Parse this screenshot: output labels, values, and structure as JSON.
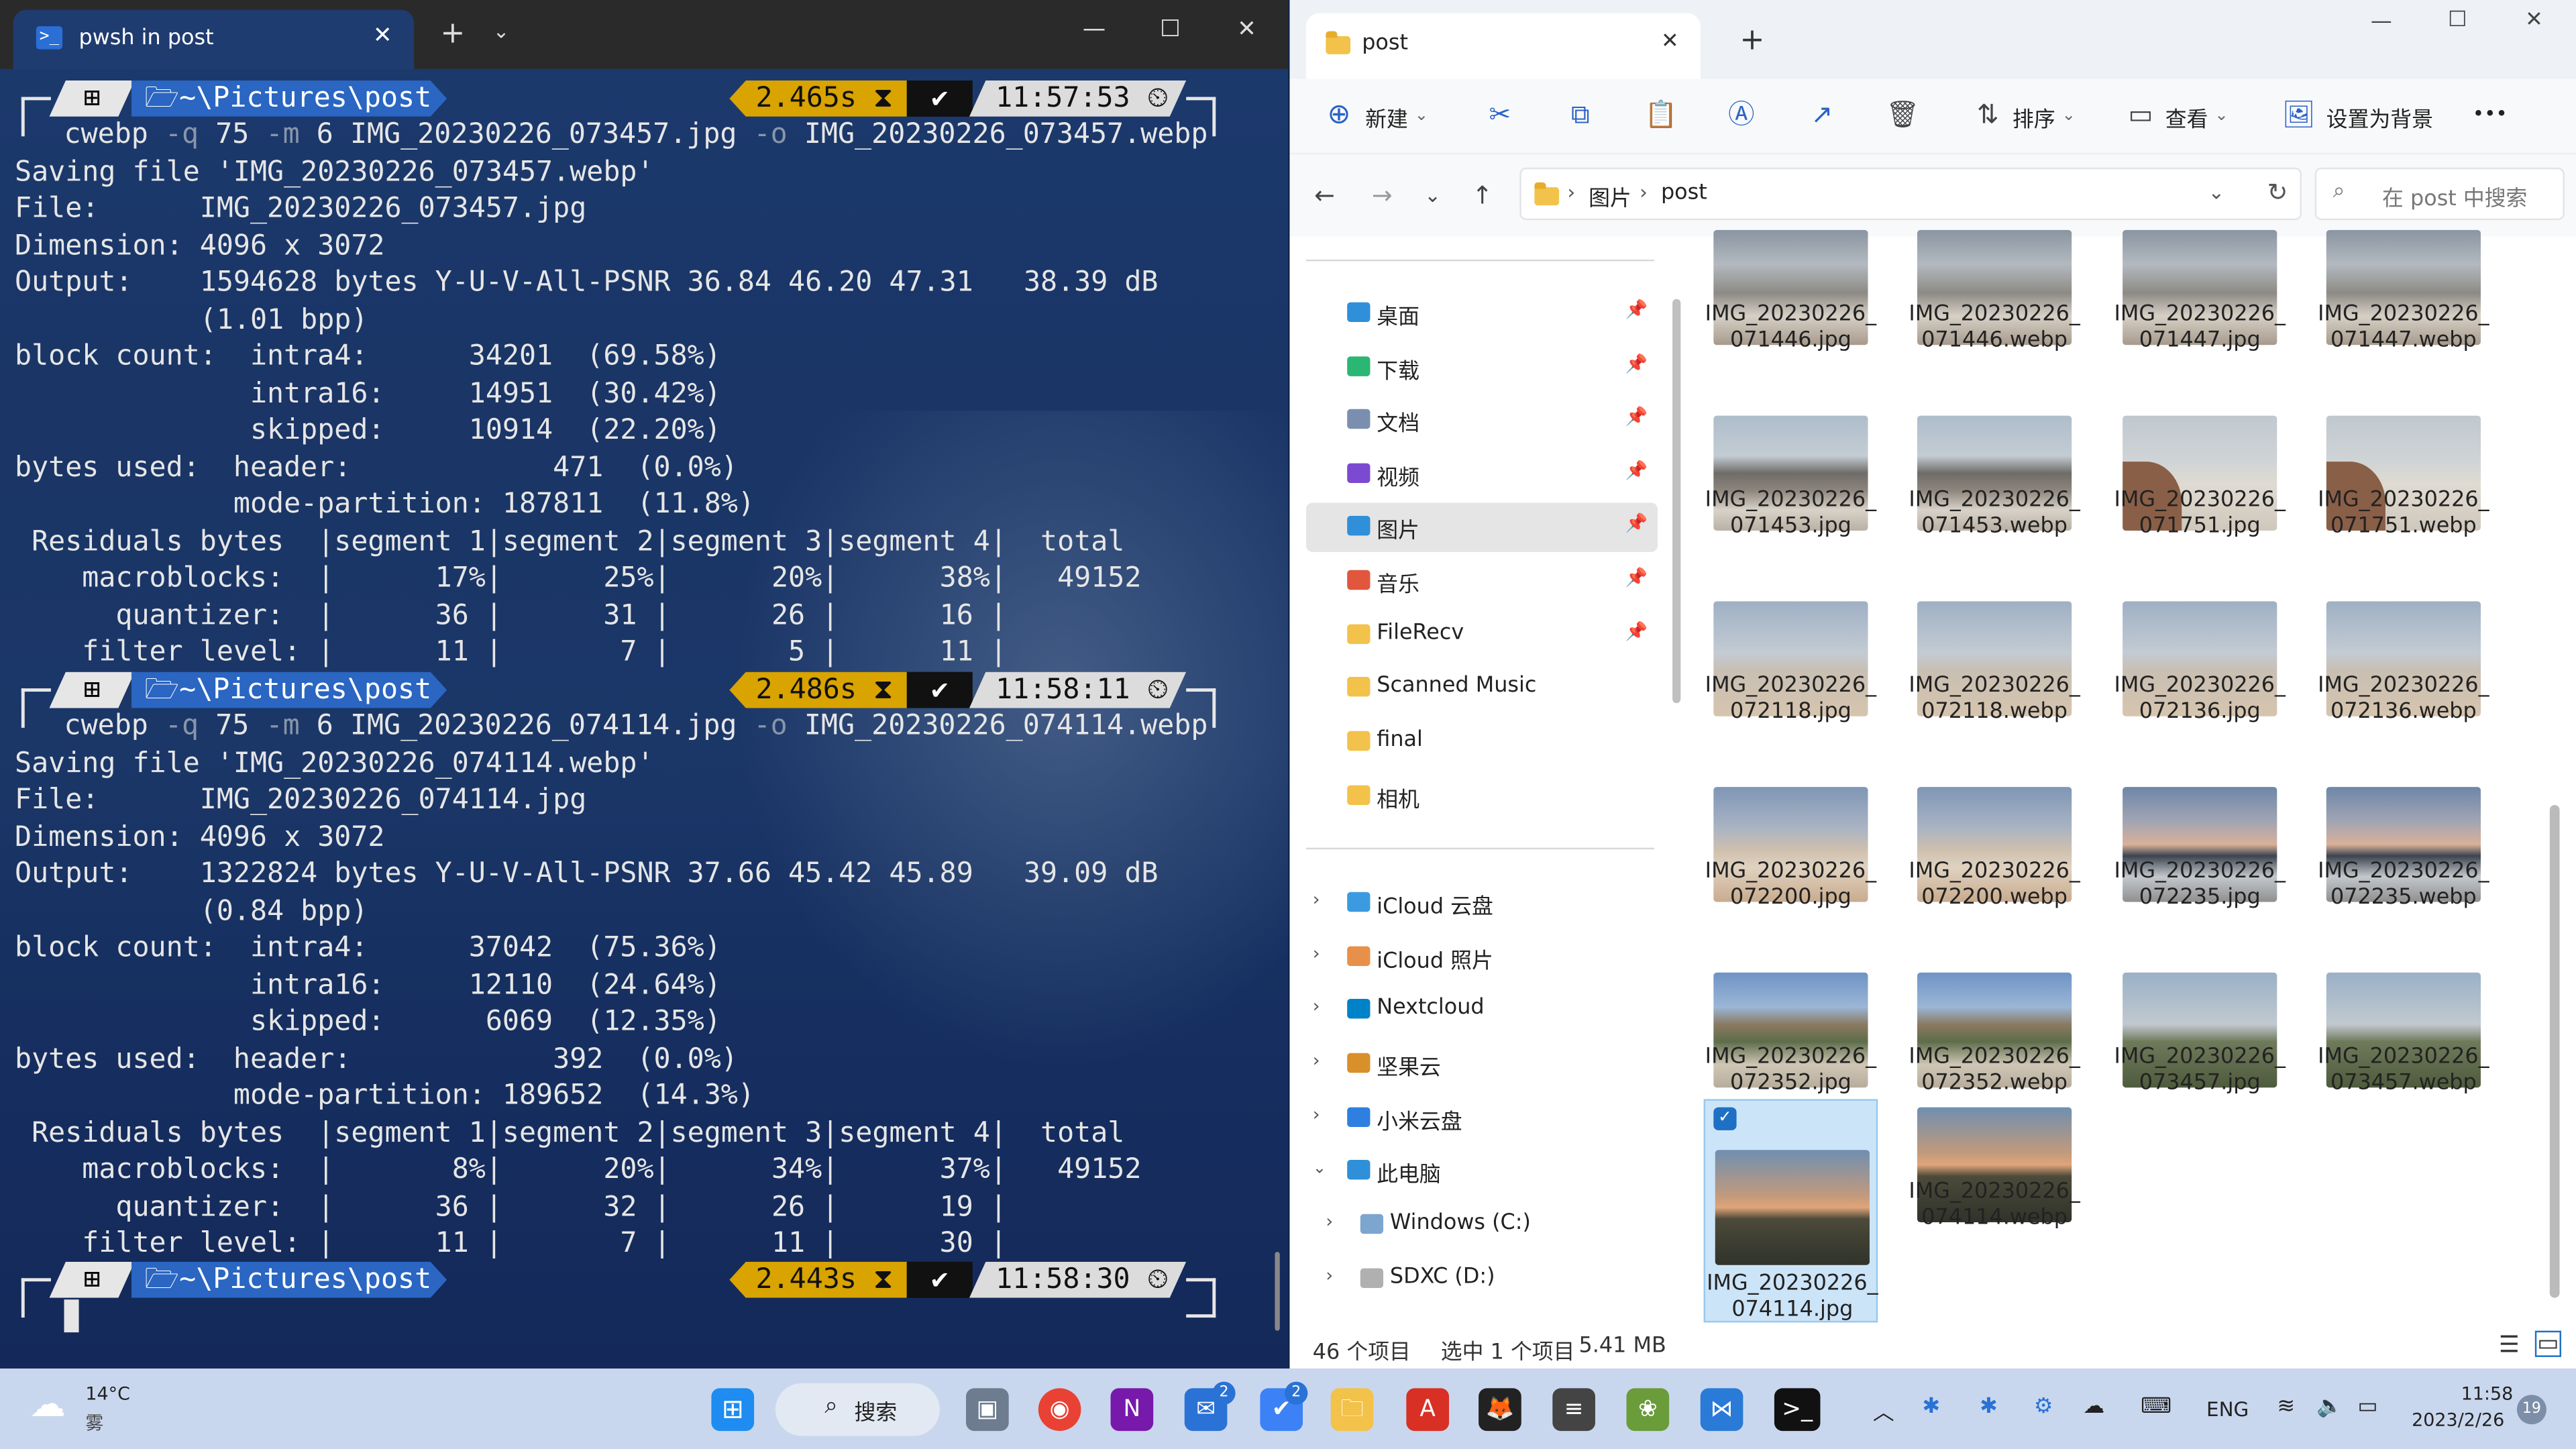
{
  "terminal": {
    "tab_title": "pwsh in post",
    "prompts": [
      {
        "path": "~\\Pictures\\post",
        "duration": "2.465s",
        "time": "11:57:53"
      },
      {
        "path": "~\\Pictures\\post",
        "duration": "2.486s",
        "time": "11:58:11"
      },
      {
        "path": "~\\Pictures\\post",
        "duration": "2.443s",
        "time": "11:58:30"
      }
    ],
    "cmd1": {
      "cwebp": "cwebp",
      "q": "-q",
      "qv": "75",
      "m": "-m",
      "mv": "6",
      "src": "IMG_20230226_073457.jpg",
      "o": "-o",
      "out": "IMG_20230226_073457.webp"
    },
    "cmd2": {
      "cwebp": "cwebp",
      "q": "-q",
      "qv": "75",
      "m": "-m",
      "mv": "6",
      "src": "IMG_20230226_074114.jpg",
      "o": "-o",
      "out": "IMG_20230226_074114.webp"
    },
    "block1": [
      "Saving file 'IMG_20230226_073457.webp'",
      "File:      IMG_20230226_073457.jpg",
      "Dimension: 4096 x 3072",
      "Output:    1594628 bytes Y-U-V-All-PSNR 36.84 46.20 47.31   38.39 dB",
      "           (1.01 bpp)",
      "block count:  intra4:      34201  (69.58%)",
      "              intra16:     14951  (30.42%)",
      "              skipped:     10914  (22.20%)",
      "bytes used:  header:            471  (0.0%)",
      "             mode-partition: 187811  (11.8%)",
      " Residuals bytes  |segment 1|segment 2|segment 3|segment 4|  total",
      "    macroblocks:  |      17%|      25%|      20%|      38%|   49152",
      "      quantizer:  |      36 |      31 |      26 |      16 |",
      "    filter level: |      11 |       7 |       5 |      11 |"
    ],
    "block2": [
      "Saving file 'IMG_20230226_074114.webp'",
      "File:      IMG_20230226_074114.jpg",
      "Dimension: 4096 x 3072",
      "Output:    1322824 bytes Y-U-V-All-PSNR 37.66 45.42 45.89   39.09 dB",
      "           (0.84 bpp)",
      "block count:  intra4:      37042  (75.36%)",
      "              intra16:     12110  (24.64%)",
      "              skipped:      6069  (12.35%)",
      "bytes used:  header:            392  (0.0%)",
      "             mode-partition: 189652  (14.3%)",
      " Residuals bytes  |segment 1|segment 2|segment 3|segment 4|  total",
      "    macroblocks:  |       8%|      20%|      34%|      37%|   49152",
      "      quantizer:  |      36 |      32 |      26 |      19 |",
      "    filter level: |      11 |       7 |      11 |      30 |"
    ]
  },
  "explorer": {
    "tab_title": "post",
    "commands": {
      "new": "新建",
      "sort": "排序",
      "view": "查看",
      "set_bg": "设置为背景",
      "more": "•••"
    },
    "breadcrumb": [
      "图片",
      "post"
    ],
    "search_placeholder": "在 post 中搜索",
    "quick_access": [
      {
        "label": "桌面",
        "color": "#2f8fd8"
      },
      {
        "label": "下载",
        "color": "#2bb673"
      },
      {
        "label": "文档",
        "color": "#7a8fb0"
      },
      {
        "label": "视频",
        "color": "#7b4ad1"
      },
      {
        "label": "图片",
        "color": "#2f8fd8"
      },
      {
        "label": "音乐",
        "color": "#e0573e"
      },
      {
        "label": "FileRecv",
        "color": "#f3c24a"
      },
      {
        "label": "Scanned Music",
        "color": "#f3c24a"
      },
      {
        "label": "final",
        "color": "#f3c24a"
      },
      {
        "label": "相机",
        "color": "#f3c24a"
      }
    ],
    "locations": [
      {
        "label": "iCloud 云盘",
        "color": "#3c9be0"
      },
      {
        "label": "iCloud 照片",
        "color": "#e8904a"
      },
      {
        "label": "Nextcloud",
        "color": "#0082c9"
      },
      {
        "label": "坚果云",
        "color": "#d9902b"
      },
      {
        "label": "小米云盘",
        "color": "#2f7fe0"
      },
      {
        "label": "此电脑",
        "color": "#2f8fd8"
      },
      {
        "label": "Windows (C:)",
        "color": "#7da6cf"
      },
      {
        "label": "SDXC (D:)",
        "color": "#b0b0b0"
      }
    ],
    "files": [
      {
        "l1": "IMG_20230226_",
        "l2": "071446.jpg",
        "thumb": "t-beach"
      },
      {
        "l1": "IMG_20230226_",
        "l2": "071446.webp",
        "thumb": "t-beach"
      },
      {
        "l1": "IMG_20230226_",
        "l2": "071447.jpg",
        "thumb": "t-beach"
      },
      {
        "l1": "IMG_20230226_",
        "l2": "071447.webp",
        "thumb": "t-beach"
      },
      {
        "l1": "IMG_20230226_",
        "l2": "071453.jpg",
        "thumb": "t-rocks"
      },
      {
        "l1": "IMG_20230226_",
        "l2": "071453.webp",
        "thumb": "t-rocks"
      },
      {
        "l1": "IMG_20230226_",
        "l2": "071751.jpg",
        "thumb": "t-bigrock"
      },
      {
        "l1": "IMG_20230226_",
        "l2": "071751.webp",
        "thumb": "t-bigrock"
      },
      {
        "l1": "IMG_20230226_",
        "l2": "072118.jpg",
        "thumb": "t-horizon"
      },
      {
        "l1": "IMG_20230226_",
        "l2": "072118.webp",
        "thumb": "t-horizon"
      },
      {
        "l1": "IMG_20230226_",
        "l2": "072136.jpg",
        "thumb": "t-horizon"
      },
      {
        "l1": "IMG_20230226_",
        "l2": "072136.webp",
        "thumb": "t-horizon"
      },
      {
        "l1": "IMG_20230226_",
        "l2": "072200.jpg",
        "thumb": "t-dusk"
      },
      {
        "l1": "IMG_20230226_",
        "l2": "072200.webp",
        "thumb": "t-dusk"
      },
      {
        "l1": "IMG_20230226_",
        "l2": "072235.jpg",
        "thumb": "t-sunset"
      },
      {
        "l1": "IMG_20230226_",
        "l2": "072235.webp",
        "thumb": "t-sunset"
      },
      {
        "l1": "IMG_20230226_",
        "l2": "072352.jpg",
        "thumb": "t-mount"
      },
      {
        "l1": "IMG_20230226_",
        "l2": "072352.webp",
        "thumb": "t-mount"
      },
      {
        "l1": "IMG_20230226_",
        "l2": "073457.jpg",
        "thumb": "t-field"
      },
      {
        "l1": "IMG_20230226_",
        "l2": "073457.webp",
        "thumb": "t-field"
      },
      {
        "l1": "IMG_20230226_",
        "l2": "074114.jpg",
        "thumb": "t-palm",
        "selected": true
      },
      {
        "l1": "IMG_20230226_",
        "l2": "074114.webp",
        "thumb": "t-palm"
      }
    ],
    "status": {
      "count": "46 个项目",
      "selected": "选中 1 个项目",
      "size": "5.41 MB"
    }
  },
  "taskbar": {
    "weather_temp": "14°C",
    "weather_desc": "雾",
    "search_label": "搜索",
    "lang": "ENG",
    "time": "11:58",
    "date": "2023/2/26",
    "badges": {
      "mail": "2",
      "todo": "2"
    },
    "notif": "19"
  }
}
